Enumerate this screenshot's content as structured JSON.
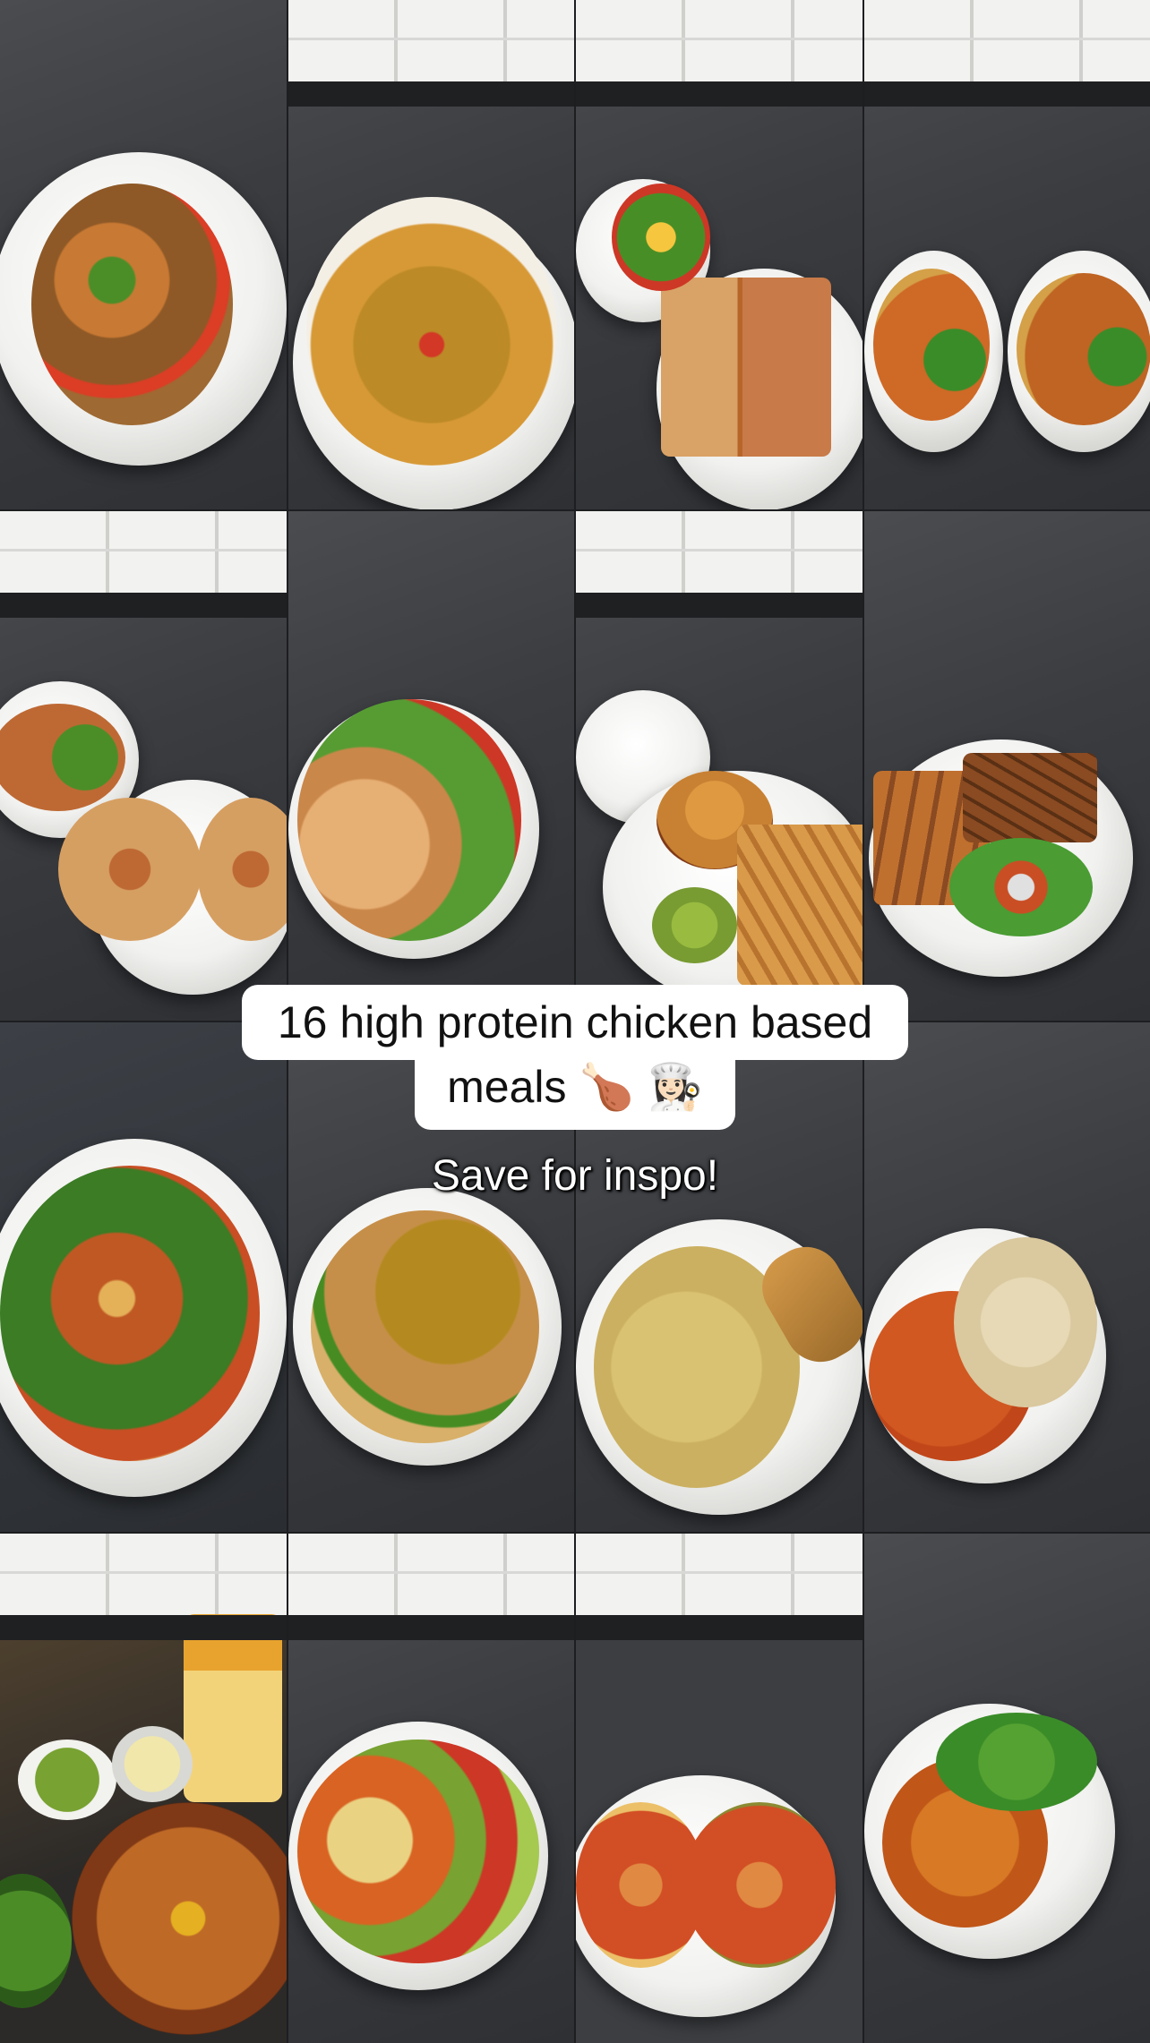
{
  "overlay": {
    "title_line1": "16 high protein chicken based",
    "title_line2": "meals 🍗 👩🏻‍🍳",
    "subtitle": "Save for inspo!"
  },
  "colors": {
    "caption_bg": "#ffffff",
    "caption_text": "#111111",
    "subtitle_text": "#ffffff",
    "countertop": "#3a3c40"
  },
  "tiles": [
    {
      "name": "loaded-potatoes-plate",
      "food": [
        "#8a5a2c",
        "#c27a3a",
        "#3f8a2a",
        "#d0402a"
      ]
    },
    {
      "name": "noodles-prawn-crackers-plate",
      "food": [
        "#b88a30",
        "#d29a40",
        "#c83a2a",
        "#f4efe6"
      ]
    },
    {
      "name": "chicken-pizza-bread-plate",
      "food": [
        "#c87a48",
        "#d9a266",
        "#4c8c2e",
        "#f2c64a"
      ]
    },
    {
      "name": "curry-tofu-broccoli-bowls",
      "food": [
        "#c76b2e",
        "#d0a050",
        "#3f8a2f",
        "#b8652a"
      ]
    },
    {
      "name": "flatbread-pizzas-plate",
      "food": [
        "#d2a068",
        "#b86a3a",
        "#4f8c2f",
        "#e6c08a"
      ]
    },
    {
      "name": "chicken-skewers-salad-plate",
      "food": [
        "#e2b07a",
        "#c58850",
        "#c23a2a",
        "#5a9a3a"
      ]
    },
    {
      "name": "burger-fries-plate",
      "food": [
        "#c2823a",
        "#b8742e",
        "#d99a4a",
        "#7a9a3a"
      ]
    },
    {
      "name": "breaded-chicken-wedges-plate",
      "food": [
        "#c0702e",
        "#8a4a22",
        "#4f9a3a",
        "#e0e0e0"
      ]
    },
    {
      "name": "chicken-salad-flatbread-plate",
      "food": [
        "#b85a2a",
        "#3f7a2a",
        "#e0b060",
        "#c0502a"
      ]
    },
    {
      "name": "curry-rice-plate",
      "food": [
        "#b08a2a",
        "#c29050",
        "#4a8a2a",
        "#d5b070"
      ]
    },
    {
      "name": "creamy-pasta-garlic-bread-plate",
      "food": [
        "#d8c27a",
        "#c9b068",
        "#d59a4a",
        "#8a7a4a"
      ]
    },
    {
      "name": "butter-chicken-rice-plate",
      "food": [
        "#c85a28",
        "#d8c8a2",
        "#b8481f",
        "#e6d9b8"
      ]
    },
    {
      "name": "fajitas-pan-toppings",
      "food": [
        "#b86a2e",
        "#e0b02e",
        "#7a3a1a",
        "#4f8a2e"
      ]
    },
    {
      "name": "nachos-bowl-plate",
      "food": [
        "#d0652a",
        "#e8d28a",
        "#7aa03a",
        "#c23a2a"
      ]
    },
    {
      "name": "chicken-pizzas-plate",
      "food": [
        "#c8502a",
        "#d98a4a",
        "#e8c070",
        "#8a5a2a"
      ]
    },
    {
      "name": "sticky-chicken-broccoli-bowl",
      "food": [
        "#b8581f",
        "#d07a2e",
        "#3f8a2f",
        "#e0d8c0"
      ]
    }
  ]
}
